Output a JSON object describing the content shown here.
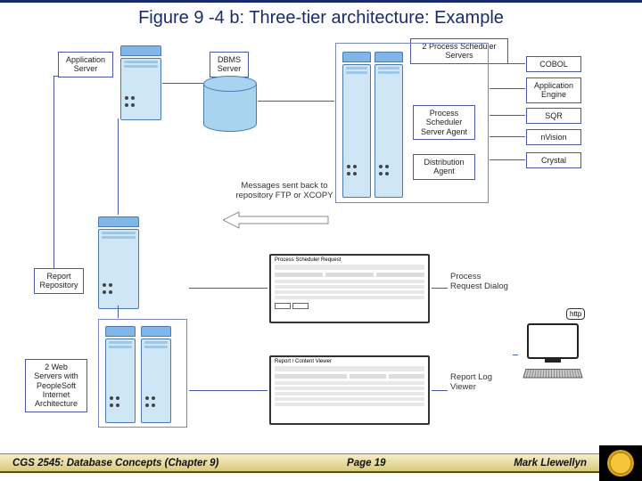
{
  "title": "Figure 9 -4 b: Three-tier architecture: Example",
  "labels": {
    "app_server": "Application\nServer",
    "dbms_server": "DBMS\nServer",
    "sched_servers": "2 Process Scheduler\nServers",
    "cobol": "COBOL",
    "app_engine": "Application\nEngine",
    "sqr": "SQR",
    "nvision": "nVision",
    "crystal": "Crystal",
    "proc_sched_agent": "Process\nScheduler\nServer Agent",
    "dist_agent": "Distribution\nAgent",
    "report_repo": "Report\nRepository",
    "web_servers": "2 Web\nServers with\nPeopleSoft\nInternet\nArchitecture",
    "proc_req_dialog": "Process\nRequest Dialog",
    "report_log_viewer": "Report Log\nViewer",
    "http_badge": "http",
    "msg": "Messages sent back to\nrepository FTP or XCOPY",
    "dialog1_title": "Process Scheduler Request",
    "dialog2_title": "Report / Content Viewer"
  },
  "footer": {
    "course": "CGS 2545: Database Concepts  (Chapter 9)",
    "page": "Page 19",
    "author": "Mark Llewellyn"
  },
  "chart_data": {
    "type": "diagram",
    "architecture": "three-tier",
    "nodes": [
      {
        "id": "app_server",
        "label": "Application Server",
        "kind": "server"
      },
      {
        "id": "dbms_server",
        "label": "DBMS Server",
        "kind": "database"
      },
      {
        "id": "sched_servers",
        "label": "2 Process Scheduler Servers",
        "kind": "server-pair"
      },
      {
        "id": "proc_sched_agent",
        "label": "Process Scheduler Server Agent",
        "kind": "component"
      },
      {
        "id": "dist_agent",
        "label": "Distribution Agent",
        "kind": "component"
      },
      {
        "id": "cobol",
        "label": "COBOL",
        "kind": "tool"
      },
      {
        "id": "app_engine",
        "label": "Application Engine",
        "kind": "tool"
      },
      {
        "id": "sqr",
        "label": "SQR",
        "kind": "tool"
      },
      {
        "id": "nvision",
        "label": "nVision",
        "kind": "tool"
      },
      {
        "id": "crystal",
        "label": "Crystal",
        "kind": "tool"
      },
      {
        "id": "report_repo",
        "label": "Report Repository",
        "kind": "server"
      },
      {
        "id": "web_servers",
        "label": "2 Web Servers with PeopleSoft Internet Architecture",
        "kind": "server-pair"
      },
      {
        "id": "proc_req_dialog",
        "label": "Process Request Dialog",
        "kind": "ui-dialog"
      },
      {
        "id": "report_log_viewer",
        "label": "Report Log Viewer",
        "kind": "ui-dialog"
      },
      {
        "id": "client",
        "label": "Client Workstation (http)",
        "kind": "client"
      }
    ],
    "edges": [
      {
        "from": "app_server",
        "to": "dbms_server"
      },
      {
        "from": "dbms_server",
        "to": "sched_servers"
      },
      {
        "from": "sched_servers",
        "to": "proc_sched_agent"
      },
      {
        "from": "sched_servers",
        "to": "dist_agent"
      },
      {
        "from": "sched_servers",
        "to": "cobol"
      },
      {
        "from": "sched_servers",
        "to": "app_engine"
      },
      {
        "from": "sched_servers",
        "to": "sqr"
      },
      {
        "from": "sched_servers",
        "to": "nvision"
      },
      {
        "from": "sched_servers",
        "to": "crystal"
      },
      {
        "from": "dist_agent",
        "to": "report_repo",
        "label": "Messages sent back to repository FTP or XCOPY"
      },
      {
        "from": "app_server",
        "to": "web_servers"
      },
      {
        "from": "report_repo",
        "to": "web_servers"
      },
      {
        "from": "web_servers",
        "to": "proc_req_dialog"
      },
      {
        "from": "web_servers",
        "to": "report_log_viewer"
      },
      {
        "from": "client",
        "to": "web_servers",
        "protocol": "http"
      }
    ]
  }
}
